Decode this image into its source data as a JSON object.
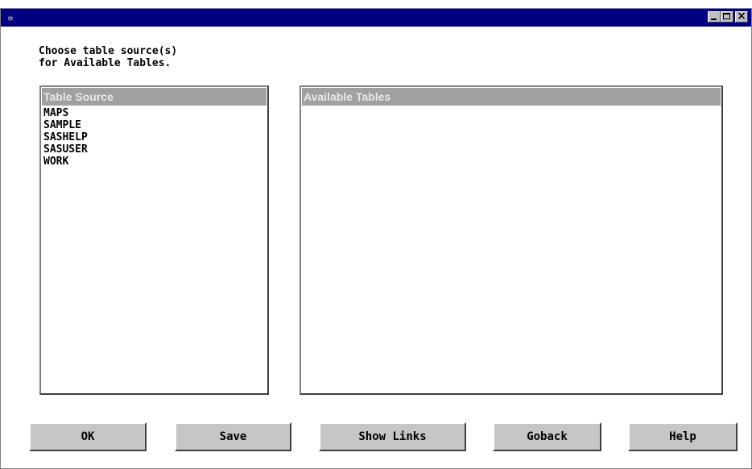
{
  "window": {
    "title": ""
  },
  "instructions": {
    "line1": "Choose table source(s)",
    "line2": "for Available Tables."
  },
  "table_source": {
    "header": "Table Source",
    "items": [
      "MAPS",
      "SAMPLE",
      "SASHELP",
      "SASUSER",
      "WORK"
    ]
  },
  "available_tables": {
    "header": "Available Tables",
    "items": []
  },
  "buttons": {
    "ok": "OK",
    "save": "Save",
    "show_links": "Show Links",
    "goback": "Goback",
    "help": "Help"
  },
  "colors": {
    "titlebar": "#000080",
    "list_header_bg": "#a0a0a0",
    "button_bg": "#c6c6c6"
  }
}
